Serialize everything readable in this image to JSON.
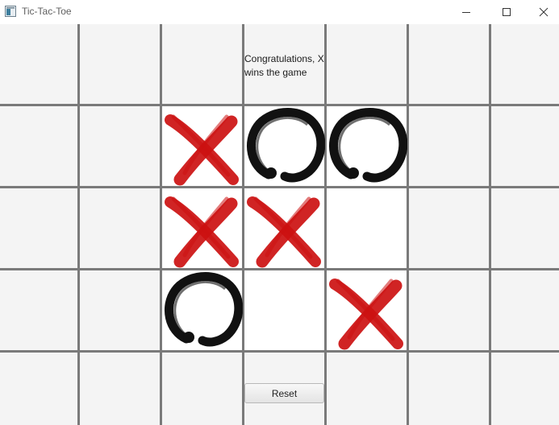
{
  "window": {
    "title": "Tic-Tac-Toe",
    "icon": "app-window-icon"
  },
  "game": {
    "message": "Congratulations, X wins the game",
    "reset_label": "Reset",
    "board": [
      [
        "X",
        "O",
        "O"
      ],
      [
        "X",
        "X",
        ""
      ],
      [
        "O",
        "",
        "X"
      ]
    ],
    "winner": "X"
  },
  "colors": {
    "x_mark": "#cc1111",
    "o_mark": "#111111",
    "grid_line": "#7a7a7a",
    "cell_background": "#ffffff",
    "outer_background": "#f4f4f4"
  },
  "icons": {
    "minimize": "minimize-icon",
    "maximize": "maximize-icon",
    "close": "close-icon"
  }
}
